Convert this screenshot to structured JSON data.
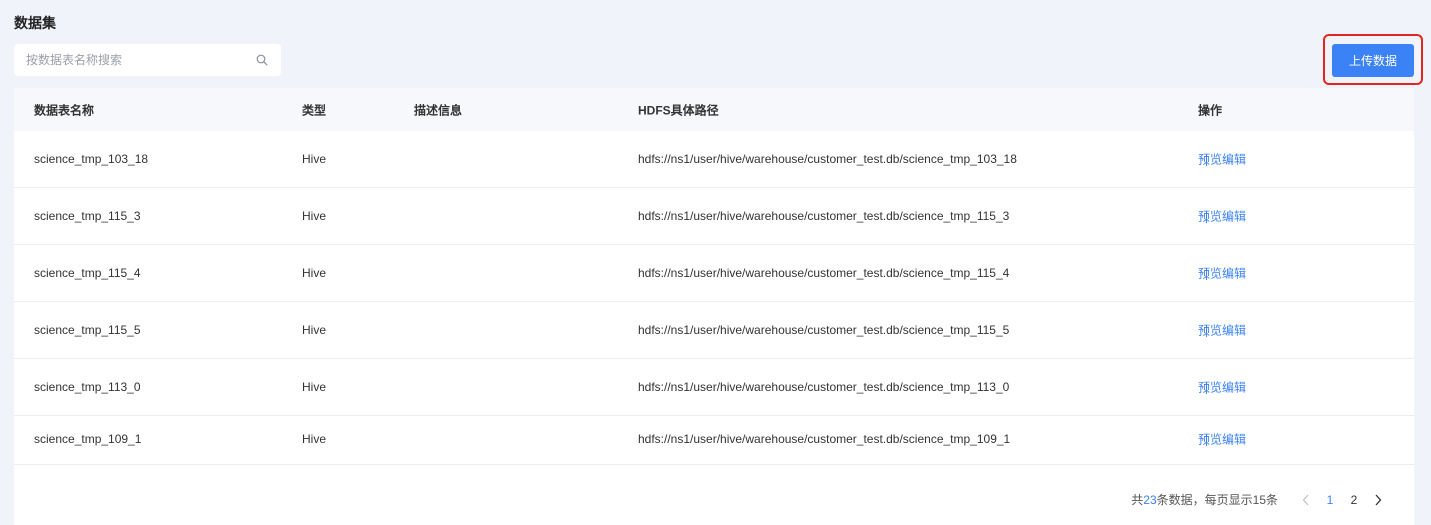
{
  "page": {
    "title": "数据集"
  },
  "search": {
    "placeholder": "按数据表名称搜索",
    "value": ""
  },
  "toolbar": {
    "upload_label": "上传数据"
  },
  "table": {
    "headers": {
      "name": "数据表名称",
      "type": "类型",
      "desc": "描述信息",
      "path": "HDFS具体路径",
      "ops": "操作"
    },
    "actions": {
      "preview": "预览",
      "separator": "|",
      "edit": "编辑"
    },
    "rows": [
      {
        "name": "science_tmp_103_18",
        "type": "Hive",
        "desc": "",
        "path": "hdfs://ns1/user/hive/warehouse/customer_test.db/science_tmp_103_18"
      },
      {
        "name": "science_tmp_115_3",
        "type": "Hive",
        "desc": "",
        "path": "hdfs://ns1/user/hive/warehouse/customer_test.db/science_tmp_115_3"
      },
      {
        "name": "science_tmp_115_4",
        "type": "Hive",
        "desc": "",
        "path": "hdfs://ns1/user/hive/warehouse/customer_test.db/science_tmp_115_4"
      },
      {
        "name": "science_tmp_115_5",
        "type": "Hive",
        "desc": "",
        "path": "hdfs://ns1/user/hive/warehouse/customer_test.db/science_tmp_115_5"
      },
      {
        "name": "science_tmp_113_0",
        "type": "Hive",
        "desc": "",
        "path": "hdfs://ns1/user/hive/warehouse/customer_test.db/science_tmp_113_0"
      },
      {
        "name": "science_tmp_109_1",
        "type": "Hive",
        "desc": "",
        "path": "hdfs://ns1/user/hive/warehouse/customer_test.db/science_tmp_109_1"
      }
    ]
  },
  "pagination": {
    "total_prefix": "共",
    "total_count": "23",
    "total_suffix": "条数据，每页显示15条",
    "pages": [
      "1",
      "2"
    ],
    "current_page": "1"
  },
  "icons": {
    "search": "search-icon",
    "prev": "chevron-left-icon",
    "next": "chevron-right-icon"
  },
  "colors": {
    "accent": "#3b82f6",
    "highlight": "#e5251d",
    "background": "#f0f4fa"
  }
}
